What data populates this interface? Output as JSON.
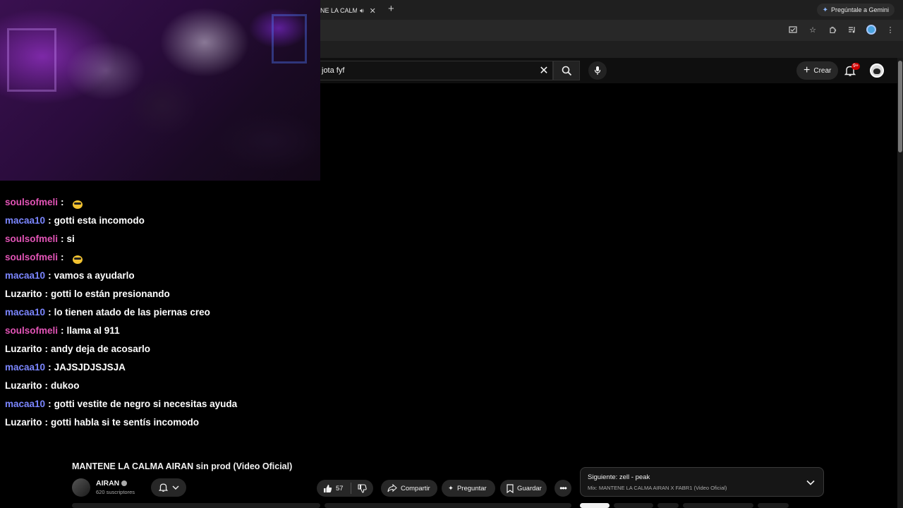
{
  "browser": {
    "tab_title": "NE LA CALMA",
    "tab_audio_icon": "speaker-icon",
    "tab_close_icon": "close-icon",
    "new_tab_label": "+",
    "gemini_label": "Pregúntale a Gemini",
    "notification_badge": "9+"
  },
  "youtube": {
    "search_value": "jota fyf",
    "create_label": "Crear"
  },
  "chat": [
    {
      "user": "soulsofmeli",
      "color": "#e254b6",
      "text": "",
      "emoji": true
    },
    {
      "user": "macaa10",
      "color": "#7b86ff",
      "text": "gotti esta incomodo"
    },
    {
      "user": "soulsofmeli",
      "color": "#e254b6",
      "text": "si"
    },
    {
      "user": "soulsofmeli",
      "color": "#e254b6",
      "text": "",
      "emoji": true
    },
    {
      "user": "macaa10",
      "color": "#7b86ff",
      "text": "vamos a ayudarlo"
    },
    {
      "user": "Luzarito",
      "color": "#ffffff",
      "text": "gotti lo están presionando"
    },
    {
      "user": "macaa10",
      "color": "#7b86ff",
      "text": "lo tienen atado de las piernas creo"
    },
    {
      "user": "soulsofmeli",
      "color": "#e254b6",
      "text": "llama al 911"
    },
    {
      "user": "Luzarito",
      "color": "#ffffff",
      "text": "andy deja de acosarlo"
    },
    {
      "user": "macaa10",
      "color": "#7b86ff",
      "text": "JAJSJDJSJSJA"
    },
    {
      "user": "Luzarito",
      "color": "#ffffff",
      "text": "dukoo"
    },
    {
      "user": "macaa10",
      "color": "#7b86ff",
      "text": "gotti vestite de negro si necesitas ayuda"
    },
    {
      "user": "Luzarito",
      "color": "#ffffff",
      "text": "gotti habla si te sentís incomodo"
    }
  ],
  "video": {
    "title": "MANTENE LA CALMA AIRAN sin prod (Video Oficial)",
    "channel": "AIRAN",
    "subscribers": "620 suscriptores",
    "likes": "57",
    "share_label": "Compartir",
    "ask_label": "Preguntar",
    "save_label": "Guardar"
  },
  "up_next": {
    "title": "Siguiente: zell - peak",
    "subtitle": "Mix: MANTENE LA CALMA AIRAN X FABR1 (Video Oficial)"
  }
}
